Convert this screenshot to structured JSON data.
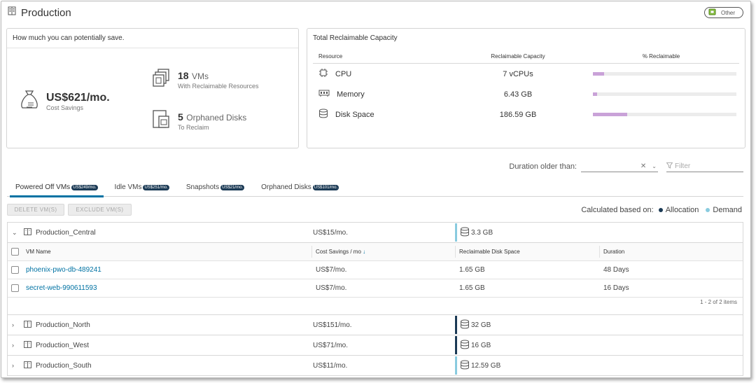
{
  "page": {
    "title": "Production",
    "other_label": "Other"
  },
  "savings": {
    "header": "How much you can potentially save.",
    "amount": "US$621/mo.",
    "amount_label": "Cost Savings",
    "vms_count": "18",
    "vms_unit": "VMs",
    "vms_label": "With Reclaimable Resources",
    "disks_count": "5",
    "disks_unit": "Orphaned Disks",
    "disks_label": "To Reclaim"
  },
  "capacity": {
    "header": "Total Reclaimable Capacity",
    "columns": [
      "Resource",
      "Reclaimable Capacity",
      "% Reclaimable"
    ],
    "rows": [
      {
        "resource": "CPU",
        "icon": "cpu-icon",
        "value": "7 vCPUs",
        "percent": 8
      },
      {
        "resource": "Memory",
        "icon": "memory-icon",
        "value": "6.43 GB",
        "percent": 3
      },
      {
        "resource": "Disk Space",
        "icon": "disk-icon",
        "value": "186.59 GB",
        "percent": 24
      }
    ]
  },
  "filters": {
    "duration_label": "Duration older than:",
    "duration_value": "",
    "filter_placeholder": "Filter"
  },
  "tabs": [
    {
      "label": "Powered Off VMs",
      "badge": "US$249/mo."
    },
    {
      "label": "Idle VMs",
      "badge": "US$251/mo."
    },
    {
      "label": "Snapshots",
      "badge": "US$21/mo."
    },
    {
      "label": "Orphaned Disks",
      "badge": "US$101/mo."
    }
  ],
  "actions": {
    "delete_label": "DELETE VM(S)",
    "exclude_label": "EXCLUDE VM(S)",
    "calc_label": "Calculated based on:",
    "allocation_label": "Allocation",
    "demand_label": "Demand"
  },
  "groups": [
    {
      "name": "Production_Central",
      "cost": "US$15/mo.",
      "disk": "3.3 GB",
      "expanded": true,
      "bar_color": "#89cbdf"
    },
    {
      "name": "Production_North",
      "cost": "US$151/mo.",
      "disk": "32 GB",
      "expanded": false,
      "bar_color": "#1b3a55"
    },
    {
      "name": "Production_West",
      "cost": "US$71/mo.",
      "disk": "16 GB",
      "expanded": false,
      "bar_color": "#1b3a55"
    },
    {
      "name": "Production_South",
      "cost": "US$11/mo.",
      "disk": "12.59 GB",
      "expanded": false,
      "bar_color": "#89cbdf"
    }
  ],
  "vm_table": {
    "columns": [
      "VM Name",
      "Cost Savings / mo",
      "Reclaimable Disk Space",
      "Duration"
    ],
    "rows": [
      {
        "name": "phoenix-pwo-db-489241",
        "cost": "US$7/mo.",
        "disk": "1.65 GB",
        "duration": "48 Days"
      },
      {
        "name": "secret-web-990611593",
        "cost": "US$7/mo.",
        "disk": "1.65 GB",
        "duration": "16 Days"
      }
    ],
    "footer": "1 - 2 of 2 items"
  }
}
